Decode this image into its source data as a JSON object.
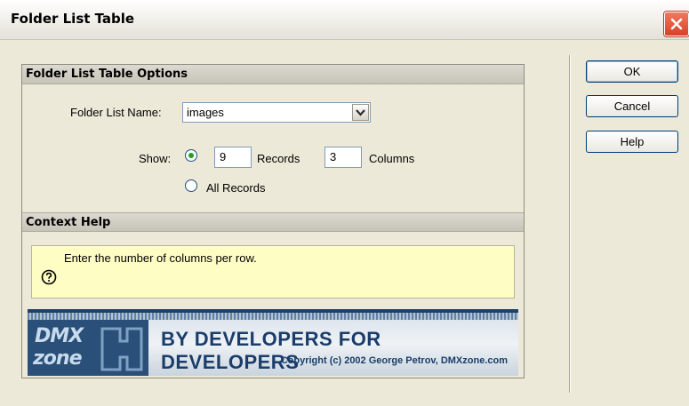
{
  "window": {
    "title": "Folder List Table"
  },
  "options": {
    "section_title": "Folder List Table Options",
    "folder_list_label": "Folder List Name:",
    "folder_list_value": "images",
    "show_label": "Show:",
    "records_count": "9",
    "records_label": "Records",
    "columns_count": "3",
    "columns_label": "Columns",
    "all_records_label": "All Records",
    "selected_show_option": "Records"
  },
  "context_help": {
    "section_title": "Context Help",
    "text": "Enter the number of columns per row."
  },
  "banner": {
    "logo_line1": "DMX",
    "logo_line2": "zone",
    "tagline": "BY DEVELOPERS FOR DEVELOPERS",
    "copyright": "Copyright (c) 2002 George Petrov, DMXzone.com"
  },
  "buttons": {
    "ok": "OK",
    "cancel": "Cancel",
    "help": "Help"
  },
  "colors": {
    "accent": "#1a3d6b",
    "help_background": "#fefec4",
    "close_button": "#d54228"
  }
}
